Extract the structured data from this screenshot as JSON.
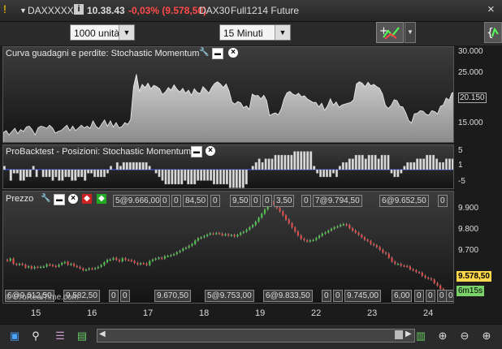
{
  "titlebar": {
    "instrument": "DAX",
    "menu_code": "XXXXX",
    "info_badge": "i",
    "time": "10.38.43",
    "change": "-0,03% (9.578,50)",
    "market": "DAX30",
    "contract": "Full1214 Future",
    "close_label": "×"
  },
  "toolbar": {
    "size_value": "1000 unità",
    "timeframe_value": "15 Minuti"
  },
  "equity_panel": {
    "title": "Curva guadagni e perdite: Stochastic Momentum",
    "yticks": [
      "30.000",
      "25.000",
      "20.150",
      "15.000"
    ],
    "series": [
      11500,
      12000,
      11000,
      11800,
      12500,
      11300,
      12200,
      11800,
      12800,
      13000,
      12200,
      11000,
      12600,
      13000,
      12800,
      12500,
      13200,
      12600,
      11400,
      11800,
      12000,
      12600,
      13200,
      12000,
      13000,
      12000,
      12600,
      13200,
      12600,
      13000,
      12500,
      14200,
      13000,
      12400,
      13500,
      14400,
      13000,
      14200,
      12800,
      13800,
      12600,
      12900,
      13800,
      13400,
      14500,
      22000,
      24800,
      21000,
      22500,
      21800,
      22800,
      21500,
      22300,
      22000,
      21500,
      20200,
      20800,
      21800,
      21200,
      22400,
      21400,
      20800,
      21600,
      20500,
      21200,
      20000,
      21500,
      20700,
      20400,
      22000,
      21300,
      20500,
      21800,
      22700,
      23100,
      22600,
      21800,
      22600,
      21000,
      18500,
      18000,
      18600,
      18300,
      17200,
      17600,
      16800,
      20300,
      19900,
      20000,
      19200,
      20000,
      18800,
      15400,
      15800,
      16000,
      15600,
      16900,
      19200,
      20600,
      20900,
      20300,
      20000,
      20500,
      19700,
      19900,
      19200,
      18800,
      18400,
      18400,
      17400,
      18200,
      16600,
      17600,
      19200,
      17800,
      18500,
      17300,
      17800,
      18000,
      18200,
      18400,
      19000,
      22600,
      23100,
      22800,
      22000,
      23000,
      22200,
      22500,
      22000,
      21600,
      20300,
      17700,
      17000,
      17700,
      19000,
      18800,
      17500,
      17400,
      16100,
      14300,
      13700,
      15800,
      15900,
      16500,
      16400,
      15700,
      15500,
      16500,
      16300,
      15800,
      17500,
      17800,
      19400,
      18900,
      20600,
      20700
    ],
    "last_value": "20.150"
  },
  "positions_panel": {
    "title": "ProBacktest - Posizioni: Stochastic Momentum",
    "yticks": [
      "5",
      "1",
      "-5"
    ],
    "series": [
      1,
      0,
      -3,
      -1,
      -1,
      -3,
      -3,
      -2,
      -2,
      1,
      -2,
      0,
      -2,
      -2,
      -2,
      -3,
      -2,
      -3,
      -3,
      -2,
      -2,
      -3,
      -3,
      -2,
      -2,
      -3,
      -1,
      -1,
      -2,
      -2,
      -2,
      -2,
      -1,
      1,
      0,
      2,
      1,
      2,
      2,
      2,
      2,
      2,
      2,
      2,
      2,
      1,
      0,
      -1,
      -2,
      -3,
      -4,
      -4,
      -4,
      -4,
      -4,
      -4,
      -3,
      -4,
      -4,
      -4,
      -3,
      -3,
      -3,
      -3,
      -3,
      -4,
      -4,
      -4,
      -4,
      -4,
      -5,
      -5,
      -5,
      -5,
      -5,
      -4,
      0,
      1,
      2,
      3,
      2,
      3,
      3,
      3,
      4,
      4,
      4,
      4,
      4,
      4,
      5,
      5,
      5,
      5,
      5,
      5,
      1,
      -1,
      -2,
      -2,
      -2,
      -2,
      -1,
      -2,
      1,
      2,
      2,
      3,
      3,
      4,
      4,
      4,
      3,
      4,
      4,
      4,
      3,
      4,
      4,
      4,
      -1,
      -2,
      -2,
      -1,
      1,
      2,
      2,
      2,
      3,
      3,
      3,
      4,
      4,
      4,
      3,
      2,
      2,
      3,
      3,
      3
    ]
  },
  "price_panel": {
    "title": "Prezzo",
    "yticks": [
      "9.900",
      "9.800",
      "9.700"
    ],
    "last_price": "9.578,50",
    "countdown": "6m15s",
    "watermark": "© ProRealTime.com",
    "top_tags": [
      "5@9.666,00",
      "0",
      "0",
      "84,50",
      "0",
      "9,50",
      "0",
      "0",
      "3,50",
      "0",
      "7@9.794,50",
      "6@9.652,50",
      "0"
    ],
    "bottom_tags": [
      "6@9.612,50",
      "9.582,50",
      "0",
      "0",
      "9.670,50",
      "5@9.753,00",
      "6@9.833,50",
      "0",
      "0",
      "9.745,00",
      "6,00",
      "0",
      "0",
      "0",
      "0"
    ],
    "candles": [
      9703,
      9710,
      9693,
      9690,
      9693,
      9690,
      9681,
      9685,
      9678,
      9683,
      9682,
      9683,
      9684,
      9691,
      9689,
      9686,
      9684,
      9690,
      9696,
      9699,
      9690,
      9693,
      9686,
      9683,
      9678,
      9672,
      9674,
      9678,
      9676,
      9679,
      9683,
      9689,
      9698,
      9706,
      9707,
      9712,
      9706,
      9701,
      9711,
      9706,
      9705,
      9702,
      9696,
      9691,
      9695,
      9694,
      9689,
      9702,
      9707,
      9710,
      9713,
      9710,
      9718,
      9719,
      9722,
      9725,
      9731,
      9736,
      9743,
      9746,
      9752,
      9758,
      9769,
      9777,
      9780,
      9784,
      9789,
      9793,
      9791,
      9794,
      9792,
      9787,
      9790,
      9786,
      9788,
      9783,
      9788,
      9795,
      9798,
      9805,
      9813,
      9820,
      9831,
      9844,
      9857,
      9871,
      9885,
      9897,
      9888,
      9876,
      9865,
      9852,
      9838,
      9826,
      9812,
      9799,
      9786,
      9775,
      9770,
      9766,
      9770,
      9771,
      9778,
      9785,
      9792,
      9796,
      9802,
      9808,
      9813,
      9816,
      9821,
      9823,
      9820,
      9810,
      9802,
      9795,
      9788,
      9780,
      9772,
      9768,
      9758,
      9754,
      9748,
      9739,
      9730,
      9726,
      9713,
      9700,
      9693,
      9693,
      9687,
      9686,
      9684,
      9675,
      9672,
      9666,
      9664,
      9654,
      9648,
      9645,
      9641,
      9630,
      9622,
      9611,
      9600,
      9594,
      9580
    ]
  },
  "xaxis": {
    "labels": [
      "15",
      "16",
      "17",
      "18",
      "19",
      "22",
      "23",
      "24"
    ]
  },
  "colors": {
    "background": "#1b1b1b",
    "panel_top": "#3c3c3c",
    "equity_fill": "#a9a9a9",
    "position_line": "#3b4fd8",
    "price_highlight": "#ffd84d",
    "countdown_bg": "#7bd16a",
    "negative": "#ff4a4a"
  },
  "icons": {
    "menu": "triangle-down-icon",
    "info": "info-icon",
    "close": "close-icon",
    "wrench": "wrench-icon",
    "window": "window-icon",
    "drawing_tools": "drawing-tools-icon",
    "indicators": "indicators-icon",
    "zoom_in": "zoom-in-icon",
    "zoom_out": "zoom-out-icon"
  }
}
